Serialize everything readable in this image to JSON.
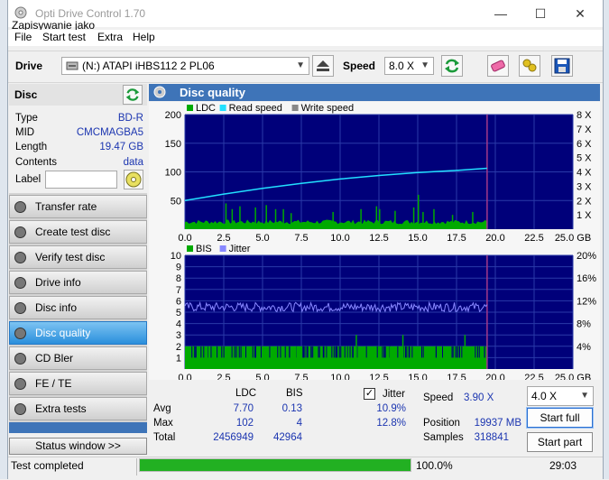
{
  "window": {
    "title": "Opti Drive Control 1.70",
    "subtitle": "Zapisywanie jako",
    "minimize": "—",
    "maximize": "☐",
    "close": "✕"
  },
  "menu": [
    "File",
    "Start test",
    "Extra",
    "Help"
  ],
  "toolbar": {
    "drive_label": "Drive",
    "drive_value": "(N:)  ATAPI iHBS112  2 PL06",
    "speed_label": "Speed",
    "speed_value": "8.0 X"
  },
  "disc": {
    "header": "Disc",
    "rows": [
      {
        "k": "Type",
        "v": "BD-R"
      },
      {
        "k": "MID",
        "v": "CMCMAGBA5"
      },
      {
        "k": "Length",
        "v": "19.47 GB"
      },
      {
        "k": "Contents",
        "v": "data"
      }
    ],
    "label_caption": "Label",
    "label_value": ""
  },
  "nav": [
    {
      "label": "Transfer rate",
      "active": false
    },
    {
      "label": "Create test disc",
      "active": false
    },
    {
      "label": "Verify test disc",
      "active": false
    },
    {
      "label": "Drive info",
      "active": false
    },
    {
      "label": "Disc info",
      "active": false
    },
    {
      "label": "Disc quality",
      "active": true
    },
    {
      "label": "CD Bler",
      "active": false
    },
    {
      "label": "FE / TE",
      "active": false
    },
    {
      "label": "Extra tests",
      "active": false
    }
  ],
  "status_window_button": "Status window >>",
  "main": {
    "title": "Disc quality"
  },
  "chart_data": [
    {
      "type": "bar",
      "legend": [
        {
          "name": "LDC",
          "color": "#00aa00"
        },
        {
          "name": "Read speed",
          "color": "#22e0ff"
        },
        {
          "name": "Write speed",
          "color": "#888888"
        }
      ],
      "x_ticks": [
        "0.0",
        "2.5",
        "5.0",
        "7.5",
        "10.0",
        "12.5",
        "15.0",
        "17.5",
        "20.0",
        "22.5",
        "25.0 GB"
      ],
      "xlim": [
        0,
        25
      ],
      "ylim": [
        0,
        200
      ],
      "y_ticks": [
        "200",
        "150",
        "100",
        "50"
      ],
      "y2_ticks": [
        "8 X",
        "7 X",
        "6 X",
        "5 X",
        "4 X",
        "3 X",
        "2 X",
        "1 X"
      ],
      "y2lim": [
        0,
        8
      ],
      "data_end_gb": 19.47,
      "ldc_baseline": 16,
      "ldc_spikes": [
        [
          2.6,
          45
        ],
        [
          3.0,
          35
        ],
        [
          3.5,
          40
        ],
        [
          4.5,
          38
        ],
        [
          5.2,
          42
        ],
        [
          5.8,
          35
        ],
        [
          6.3,
          35
        ],
        [
          6.8,
          28
        ],
        [
          9.5,
          30
        ],
        [
          11.3,
          35
        ],
        [
          12.3,
          40
        ],
        [
          12.5,
          35
        ],
        [
          13.5,
          32
        ],
        [
          14.7,
          38
        ],
        [
          15.0,
          60
        ],
        [
          15.3,
          30
        ],
        [
          16.0,
          35
        ],
        [
          17.2,
          25
        ],
        [
          18.5,
          30
        ]
      ],
      "read_speed": [
        [
          0,
          2.0
        ],
        [
          2.5,
          2.45
        ],
        [
          5.0,
          2.85
        ],
        [
          7.5,
          3.2
        ],
        [
          10.0,
          3.5
        ],
        [
          12.5,
          3.75
        ],
        [
          15.0,
          3.95
        ],
        [
          17.5,
          4.1
        ],
        [
          19.47,
          4.25
        ]
      ],
      "grid": true
    },
    {
      "type": "bar",
      "legend": [
        {
          "name": "BIS",
          "color": "#00aa00"
        },
        {
          "name": "Jitter",
          "color": "#8888ff"
        }
      ],
      "x_ticks": [
        "0.0",
        "2.5",
        "5.0",
        "7.5",
        "10.0",
        "12.5",
        "15.0",
        "17.5",
        "20.0",
        "22.5",
        "25.0 GB"
      ],
      "xlim": [
        0,
        25
      ],
      "ylim": [
        0,
        10
      ],
      "y_ticks": [
        "10",
        "9",
        "8",
        "7",
        "6",
        "5",
        "4",
        "3",
        "2",
        "1"
      ],
      "y2_ticks": [
        "20%",
        "16%",
        "12%",
        "8%",
        "4%"
      ],
      "y2lim": [
        0,
        20
      ],
      "data_end_gb": 19.47,
      "bis_baseline": 1,
      "bis_spikes": [
        [
          0.5,
          2
        ],
        [
          1.5,
          2
        ],
        [
          3.8,
          2
        ],
        [
          5.0,
          2
        ],
        [
          7.2,
          2
        ],
        [
          9.0,
          2
        ],
        [
          10.5,
          2
        ],
        [
          11.0,
          3
        ],
        [
          11.8,
          2
        ],
        [
          13.2,
          2
        ],
        [
          14.0,
          3
        ],
        [
          16.4,
          2
        ],
        [
          18.0,
          3
        ]
      ],
      "jitter_avg": 10.9,
      "grid": true
    }
  ],
  "stats": {
    "col_ldc": "LDC",
    "col_bis": "BIS",
    "jitter_label": "Jitter",
    "jitter_checked": true,
    "rows": [
      {
        "k": "Avg",
        "ldc": "7.70",
        "bis": "0.13",
        "jit": "10.9%"
      },
      {
        "k": "Max",
        "ldc": "102",
        "bis": "4",
        "jit": "12.8%"
      },
      {
        "k": "Total",
        "ldc": "2456949",
        "bis": "42964",
        "jit": ""
      }
    ],
    "speed_label": "Speed",
    "speed_value": "3.90 X",
    "position_label": "Position",
    "position_value": "19937 MB",
    "samples_label": "Samples",
    "samples_value": "318841",
    "speed_select": "4.0 X",
    "start_full": "Start full",
    "start_part": "Start part"
  },
  "status": {
    "text": "Test completed",
    "progress": 100.0,
    "progress_label": "100.0%",
    "time": "29:03"
  },
  "colors": {
    "accent": "#3e74b8",
    "chart_bg": "#00007a",
    "ldc": "#00aa00",
    "read_speed": "#22e0ff",
    "jitter": "#8888ff",
    "progress": "#22b022",
    "value_text": "#1b35b0"
  }
}
